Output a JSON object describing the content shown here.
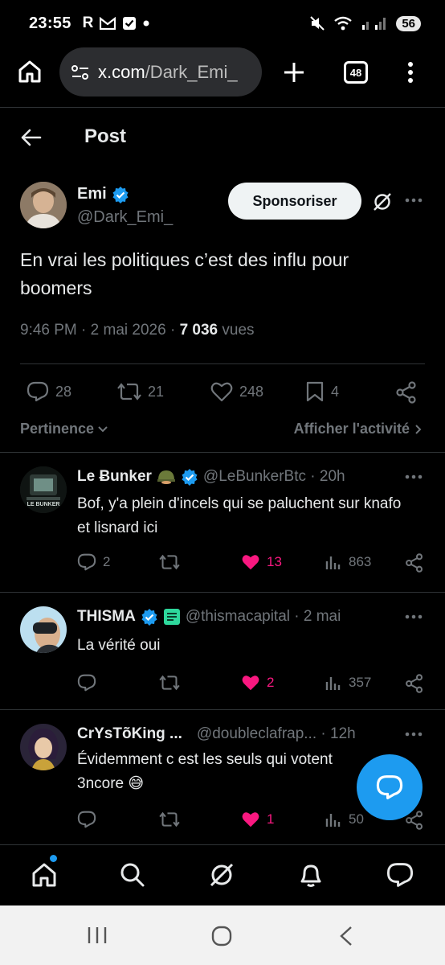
{
  "status_bar": {
    "time": "23:55",
    "notif_letters": [
      "R"
    ],
    "battery": "56"
  },
  "browser": {
    "url_host": "x.com",
    "url_path": "/Dark_Emi_",
    "tab_count": "48"
  },
  "header": {
    "title": "Post"
  },
  "post": {
    "author_name": "Emi",
    "author_handle": "@Dark_Emi_",
    "sponsor_label": "Sponsoriser",
    "text": "En vrai les politiques c’est des influ pour boomers",
    "time": "9:46 PM",
    "date": "2 mai 2026",
    "views": "7 036",
    "views_label": "vues",
    "replies": "28",
    "reposts": "21",
    "likes": "248",
    "bookmarks": "4"
  },
  "sort": {
    "left": "Pertinence",
    "right": "Afficher l'activité"
  },
  "replies": [
    {
      "name": "Le Ƀunker",
      "handle": "@LeBunkerBtc · 20h",
      "text": "Bof, y'a plein d'incels qui se paluchent sur knafo et lisnard ici",
      "avatar_text": "LE BUNKER",
      "replies": "2",
      "reposts": "",
      "likes": "13",
      "views": "863"
    },
    {
      "name": "THISMA",
      "handle": "@thismacapital · 2 mai",
      "text": "La vérité oui",
      "replies": "",
      "reposts": "",
      "likes": "2",
      "views": "357"
    },
    {
      "name": "CrYsTõKing ...",
      "handle": "@doubleclafrap... · 12h",
      "text": "Évidemment c est les seuls qui votent 3ncore 😅",
      "replies": "",
      "reposts": "",
      "likes": "1",
      "views": "50"
    }
  ],
  "colors": {
    "accent": "#1d9bf0",
    "like": "#f91880",
    "muted": "#71767b",
    "text": "#e7e9ea"
  }
}
